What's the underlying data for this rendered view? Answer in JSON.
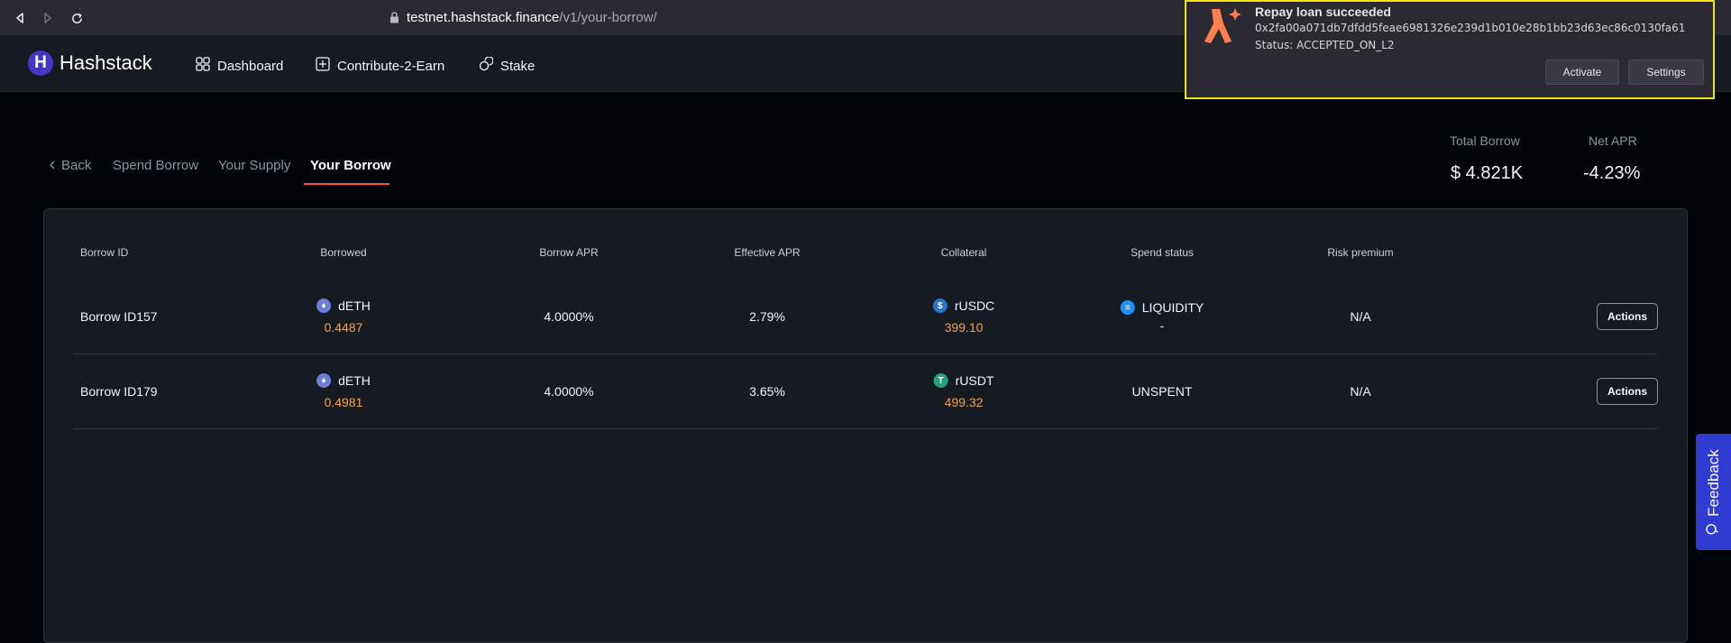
{
  "browser": {
    "url_host": "testnet.hashstack.finance",
    "url_path": "/v1/your-borrow/"
  },
  "nav": {
    "logo": "Hashstack",
    "items": [
      {
        "label": "Dashboard",
        "icon": "grid-icon"
      },
      {
        "label": "Contribute-2-Earn",
        "icon": "plus-square-icon"
      },
      {
        "label": "Stake",
        "icon": "stake-icon"
      }
    ]
  },
  "tabs": {
    "back": "Back",
    "spend_borrow": "Spend Borrow",
    "your_supply": "Your Supply",
    "your_borrow": "Your Borrow",
    "active": "Your Borrow"
  },
  "stats": {
    "total_borrow_label": "Total Borrow",
    "total_borrow_value": "$ 4.821K",
    "net_apr_label": "Net APR",
    "net_apr_value": "-4.23%"
  },
  "table": {
    "headers": [
      "Borrow ID",
      "Borrowed",
      "Borrow APR",
      "Effective APR",
      "Collateral",
      "Spend status",
      "Risk premium"
    ],
    "rows": [
      {
        "id": "Borrow ID157",
        "borrowed_token": "dETH",
        "borrowed_amount": "0.4487",
        "borrow_apr": "4.0000%",
        "effective_apr": "2.79%",
        "collateral_token": "rUSDC",
        "collateral_amount": "399.10",
        "spend_status": "LIQUIDITY",
        "spend_sub": "-",
        "risk_premium": "N/A",
        "action": "Actions"
      },
      {
        "id": "Borrow ID179",
        "borrowed_token": "dETH",
        "borrowed_amount": "0.4981",
        "borrow_apr": "4.0000%",
        "effective_apr": "3.65%",
        "collateral_token": "rUSDT",
        "collateral_amount": "499.32",
        "spend_status": "UNSPENT",
        "risk_premium": "N/A",
        "action": "Actions"
      }
    ]
  },
  "notification": {
    "title": "Repay loan succeeded",
    "hash": "0x2fa00a071db7dfdd5feae6981326e239d1b010e28b1bb23d63ec86c0130fa61",
    "status": "Status: ACCEPTED_ON_L2",
    "activate": "Activate",
    "settings": "Settings"
  },
  "feedback": "Feedback",
  "colors": {
    "accent_underline": "#f85149",
    "amount": "#f0a34b",
    "notif_border": "#f2e218",
    "feedback_bg": "#2f3bd1"
  }
}
